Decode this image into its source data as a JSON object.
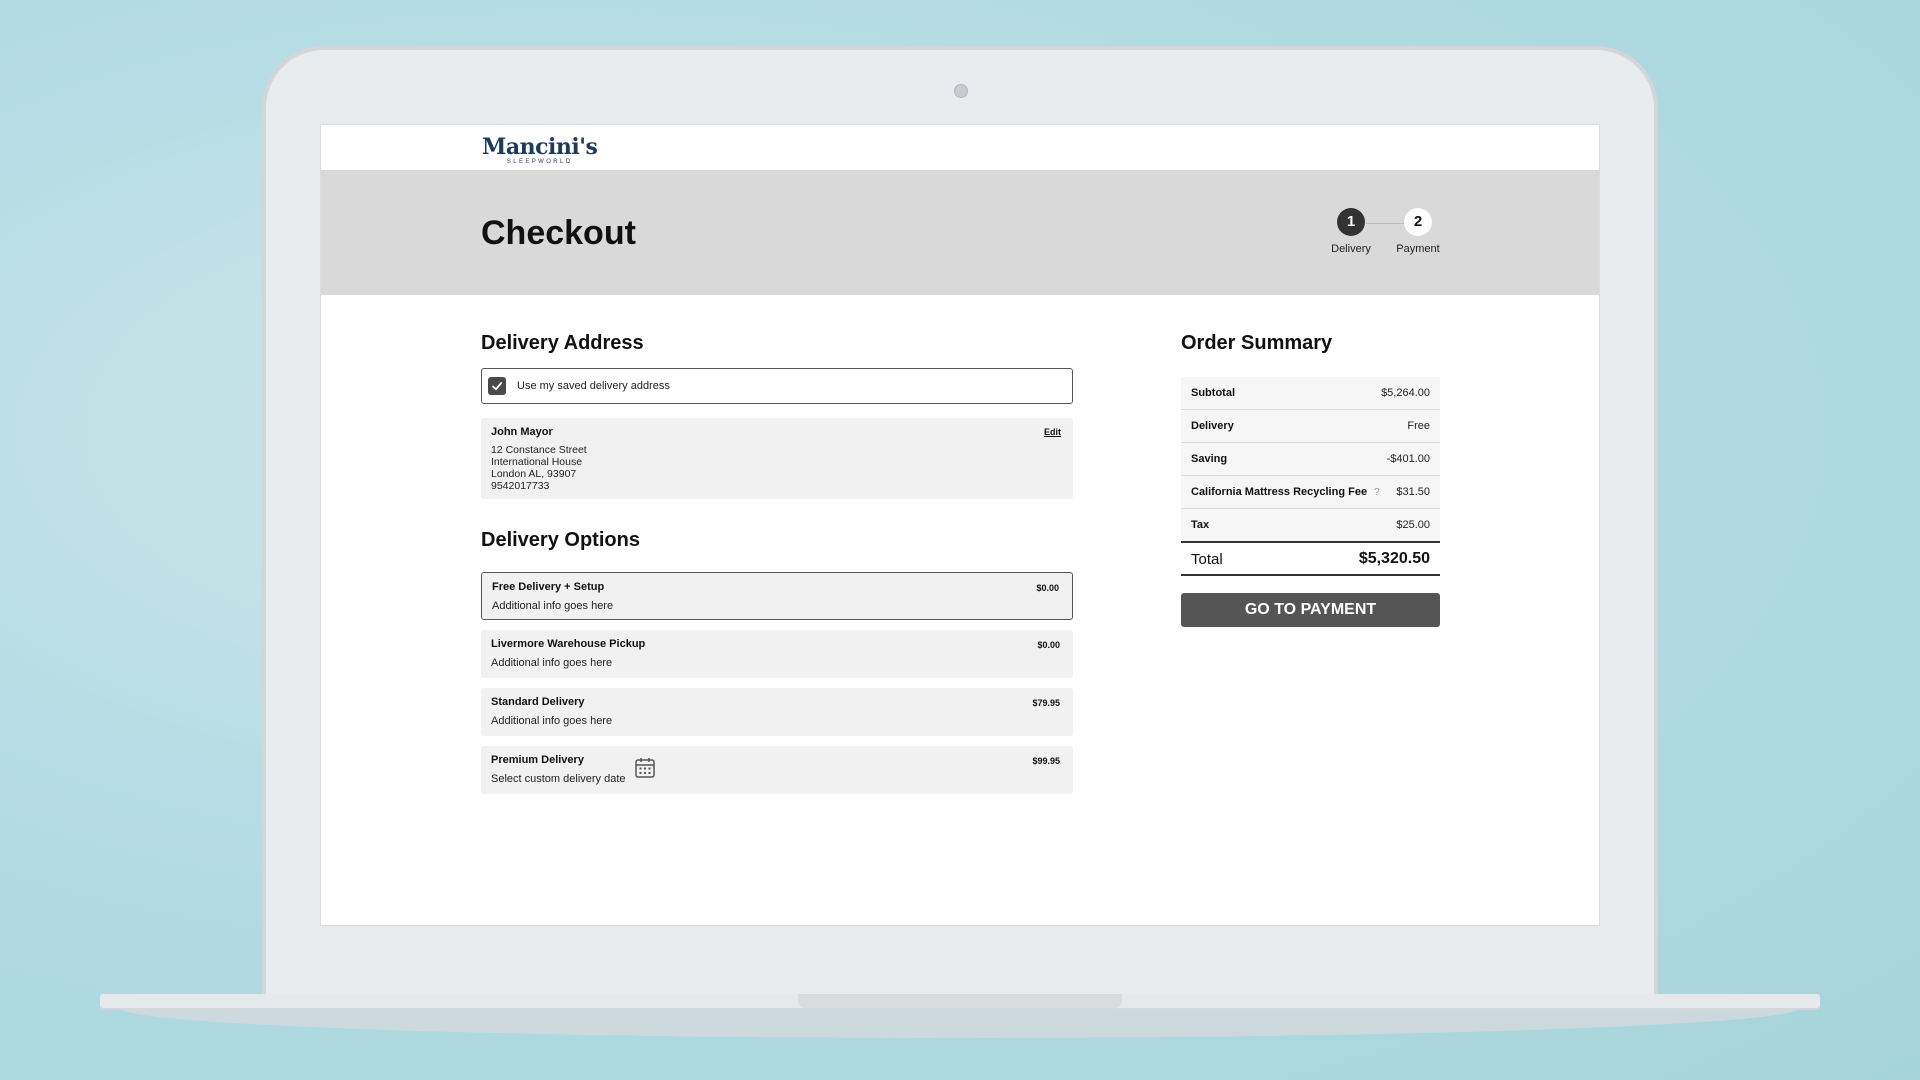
{
  "brand": {
    "name": "Mancini's",
    "tagline": "SLEEPWORLD"
  },
  "page": {
    "title": "Checkout"
  },
  "stepper": {
    "steps": [
      {
        "number": "1",
        "label": "Delivery",
        "active": true
      },
      {
        "number": "2",
        "label": "Payment",
        "active": false
      }
    ]
  },
  "delivery_address": {
    "title": "Delivery Address",
    "saved_address_label": "Use my saved delivery address",
    "saved_address_checked": true,
    "edit_label": "Edit",
    "name": "John Mayor",
    "lines": [
      "12 Constance Street",
      "International House",
      "London AL, 93907",
      "9542017733"
    ]
  },
  "delivery_options": {
    "title": "Delivery Options",
    "items": [
      {
        "title": "Free Delivery + Setup",
        "info": "Additional info goes here",
        "price": "$0.00",
        "selected": true
      },
      {
        "title": "Livermore Warehouse Pickup",
        "info": "Additional info goes here",
        "price": "$0.00",
        "selected": false
      },
      {
        "title": "Standard Delivery",
        "info": "Additional info goes here",
        "price": "$79.95",
        "selected": false
      },
      {
        "title": "Premium Delivery",
        "info": "Select custom delivery date",
        "price": "$99.95",
        "selected": false,
        "icon": "calendar-icon"
      }
    ]
  },
  "order_summary": {
    "title": "Order Summary",
    "rows": [
      {
        "label": "Subtotal",
        "value": "$5,264.00"
      },
      {
        "label": "Delivery",
        "value": "Free"
      },
      {
        "label": "Saving",
        "value": "-$401.00"
      },
      {
        "label": "California Mattress Recycling Fee",
        "value": "$31.50",
        "info_icon": "?"
      },
      {
        "label": "Tax",
        "value": "$25.00"
      }
    ],
    "total_label": "Total",
    "total_value": "$5,320.50"
  },
  "actions": {
    "go_to_payment": "GO TO PAYMENT"
  },
  "colors": {
    "background": "#b5dde3",
    "hero_bar": "#d9d9d9",
    "active_step": "#333333",
    "button": "#555555",
    "brand": "#1f3b5c"
  }
}
